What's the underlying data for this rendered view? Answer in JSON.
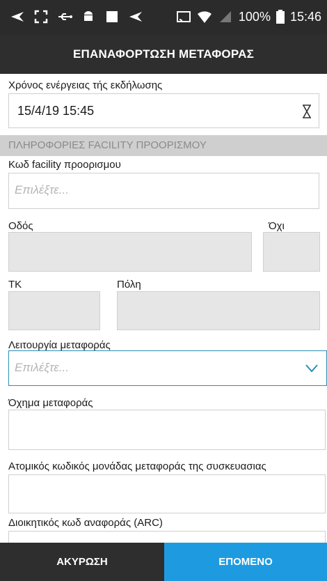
{
  "status_bar": {
    "battery": "100%",
    "time": "15:46"
  },
  "header": {
    "title": "ΕΠΑΝΑΦΟΡΤΩΣΗ ΜΕΤΑΦΟΡΑΣ"
  },
  "form": {
    "event_time": {
      "label": "Χρόνος ενέργειας τής εκδήλωσης",
      "value": "15/4/19 15:45"
    },
    "section_title": "ΠΛΗΡΟΦΟΡΙΕΣ FACILITY ΠΡΟΟΡΙΣΜΟΥ",
    "facility_code": {
      "label": "Κωδ facility προορισμου",
      "placeholder": "Επιλέξτε..."
    },
    "street": {
      "label": "Οδός"
    },
    "number": {
      "label": "Όχι"
    },
    "postal_code": {
      "label": "ΤΚ"
    },
    "city": {
      "label": "Πόλη"
    },
    "transport_mode": {
      "label": "Λειτουργία μεταφοράς",
      "placeholder": "Επιλέξτε..."
    },
    "vehicle": {
      "label": "Όχημα μεταφοράς"
    },
    "unit_code": {
      "label": "Ατομικός κωδικός μονάδας μεταφοράς της συσκευασιας"
    },
    "arc": {
      "label": "Διοικητικός κωδ αναφοράς (ARC)"
    }
  },
  "footer": {
    "cancel_label": "ΑΚΥΡΩΣΗ",
    "next_label": "ΕΠΟΜΕΝΟ"
  },
  "colors": {
    "accent": "#1e9be0",
    "focus_border": "#2a8fb8",
    "bar": "#2e2e2e"
  }
}
